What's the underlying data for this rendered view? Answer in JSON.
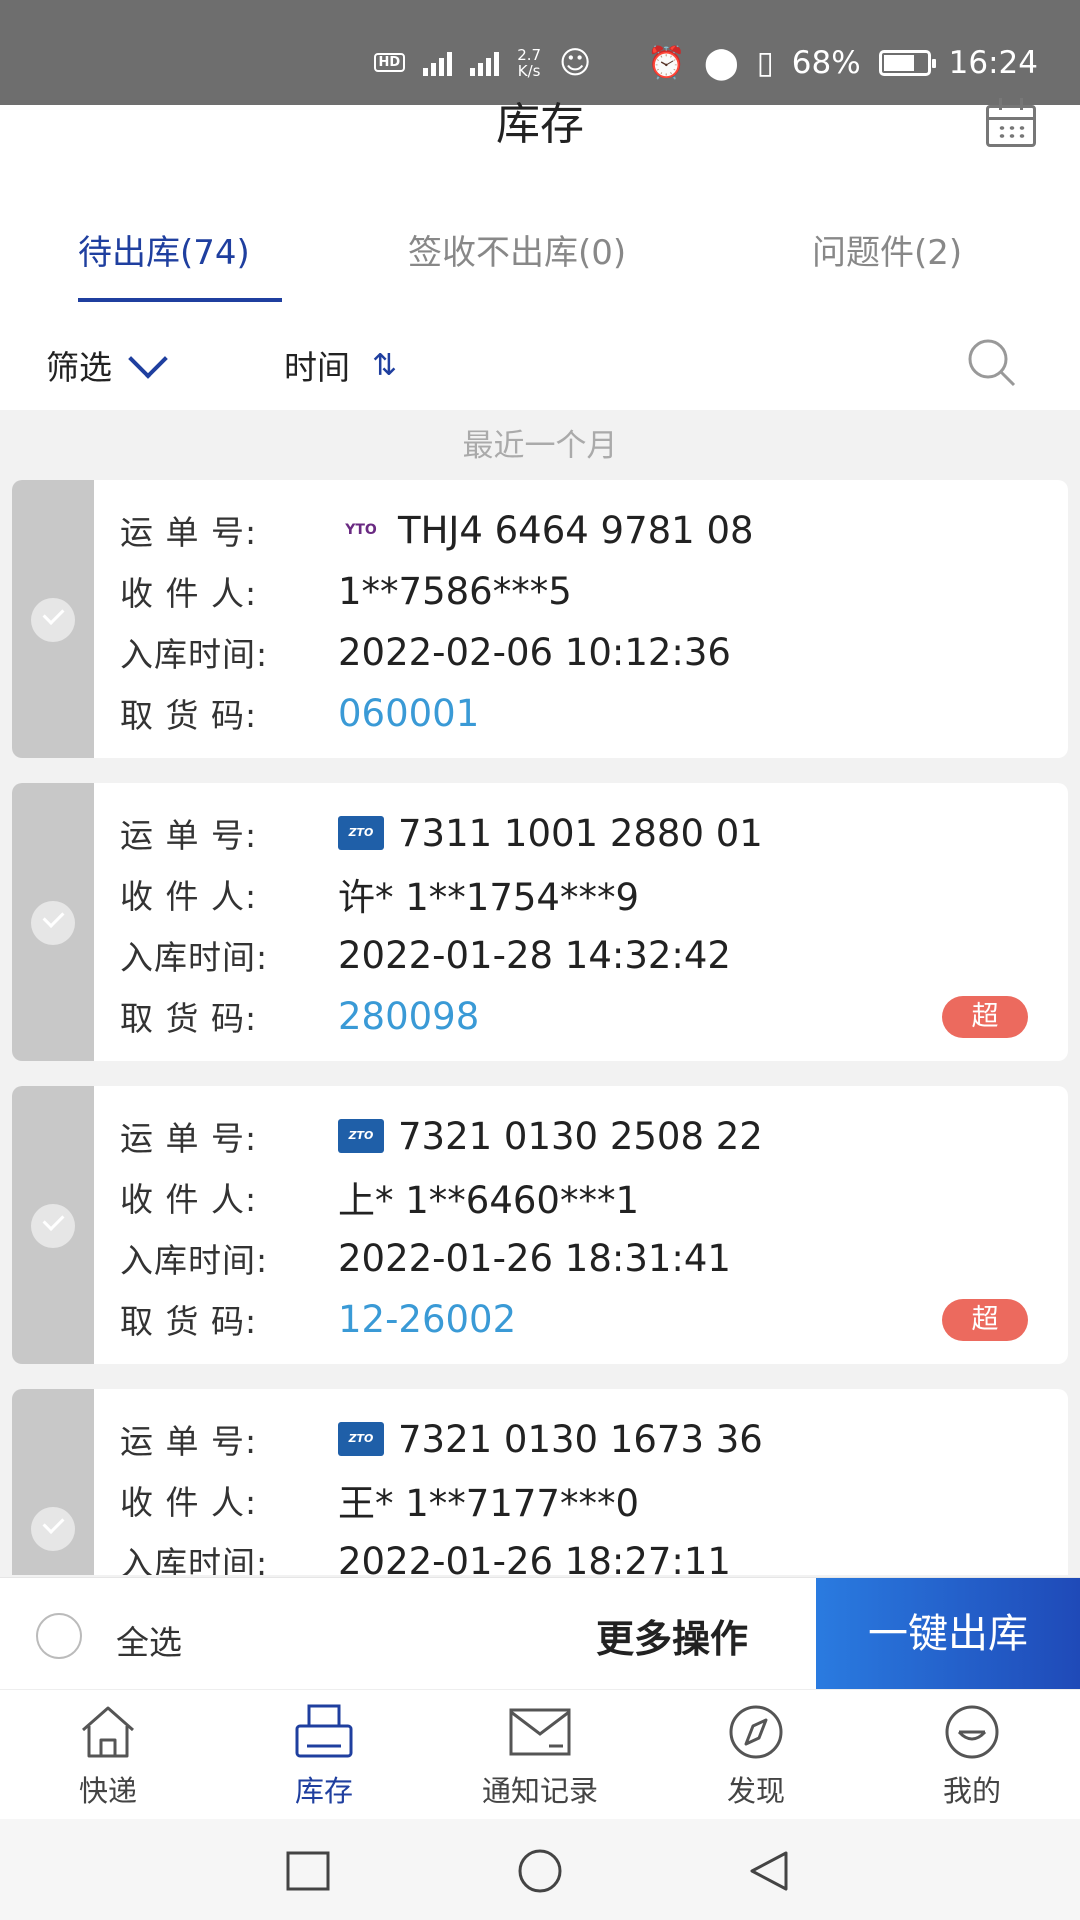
{
  "status_bar": {
    "network_speed": "2.7",
    "network_unit": "K/s",
    "battery": "68%",
    "time": "16:24"
  },
  "header": {
    "title": "库存"
  },
  "tabs": [
    {
      "label": "待出库(74)"
    },
    {
      "label": "签收不出库(0)"
    },
    {
      "label": "问题件(2)"
    }
  ],
  "filters": {
    "filter_label": "筛选",
    "time_label": "时间"
  },
  "section_label": "最近一个月",
  "field_labels": {
    "waybill": "运 单 号:",
    "recipient": "收 件 人:",
    "stored_time": "入库时间:",
    "pickup_code": "取 货 码:"
  },
  "packages": [
    {
      "carrier_logo": "YTO",
      "waybill": "THJ4 6464 9781 08",
      "recipient": "1**7586***5",
      "stored_time": "2022-02-06 10:12:36",
      "pickup_code": "060001"
    },
    {
      "carrier_logo": "ZTO",
      "waybill": "7311 1001 2880 01",
      "recipient": "许* 1**1754***9",
      "stored_time": "2022-01-28 14:32:42",
      "pickup_code": "280098",
      "badge": "超"
    },
    {
      "carrier_logo": "ZTO",
      "waybill": "7321 0130 2508 22",
      "recipient": "上* 1**6460***1",
      "stored_time": "2022-01-26 18:31:41",
      "pickup_code": "12-26002",
      "badge": "超"
    },
    {
      "carrier_logo": "ZTO",
      "waybill": "7321 0130 1673 36",
      "recipient": "王* 1**7177***0",
      "stored_time": "2022-01-26 18:27:11"
    }
  ],
  "bottom_actions": {
    "select_all": "全选",
    "more_ops": "更多操作",
    "one_click_outbound": "一键出库"
  },
  "tabbar": [
    {
      "label": "快递",
      "icon": "home-icon"
    },
    {
      "label": "库存",
      "icon": "printer-icon"
    },
    {
      "label": "通知记录",
      "icon": "mail-icon"
    },
    {
      "label": "发现",
      "icon": "compass-icon"
    },
    {
      "label": "我的",
      "icon": "profile-icon"
    }
  ],
  "colors": {
    "accent": "#1f3f9f",
    "pickup_code": "#3a9ad6",
    "badge": "#ec6a5e"
  }
}
